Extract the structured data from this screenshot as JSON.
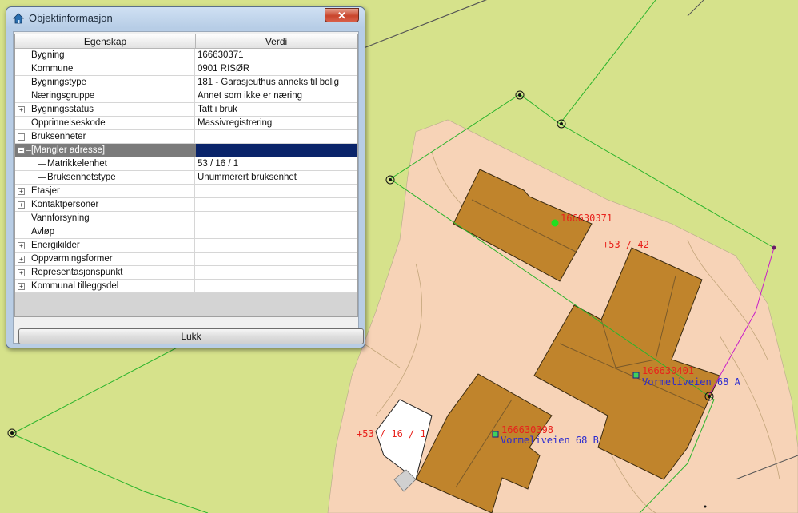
{
  "window": {
    "title": "Objektinformasjon",
    "close_glyph": "✕",
    "close_label": "Lukk"
  },
  "table": {
    "columns": [
      "Egenskap",
      "Verdi"
    ],
    "rows": [
      {
        "label": "Bygning",
        "value": "166630371",
        "expander": "",
        "indent": 0
      },
      {
        "label": "Kommune",
        "value": "0901  RISØR",
        "expander": "",
        "indent": 0
      },
      {
        "label": "Bygningstype",
        "value": "181 - Garasjeuthus anneks til bolig",
        "expander": "",
        "indent": 0
      },
      {
        "label": "Næringsgruppe",
        "value": "Annet som ikke er næring",
        "expander": "",
        "indent": 0
      },
      {
        "label": "Bygningsstatus",
        "value": "Tatt i bruk",
        "expander": "+",
        "indent": 0
      },
      {
        "label": "Opprinnelseskode",
        "value": "Massivregistrering",
        "expander": "",
        "indent": 0
      },
      {
        "label": "Bruksenheter",
        "value": "",
        "expander": "−",
        "indent": 0
      },
      {
        "label": "[Mangler adresse]",
        "value": "",
        "expander": "−",
        "indent": 1,
        "selected": true
      },
      {
        "label": "Matrikkelenhet",
        "value": "53 / 16 / 1",
        "expander": "",
        "indent": 2
      },
      {
        "label": "Bruksenhetstype",
        "value": "Unummerert bruksenhet",
        "expander": "",
        "indent": 2
      },
      {
        "label": "Etasjer",
        "value": "",
        "expander": "+",
        "indent": 0
      },
      {
        "label": "Kontaktpersoner",
        "value": "",
        "expander": "+",
        "indent": 0
      },
      {
        "label": "Vannforsyning",
        "value": "",
        "expander": "",
        "indent": 0
      },
      {
        "label": "Avløp",
        "value": "",
        "expander": "",
        "indent": 0
      },
      {
        "label": "Energikilder",
        "value": "",
        "expander": "+",
        "indent": 0
      },
      {
        "label": "Oppvarmingsformer",
        "value": "",
        "expander": "+",
        "indent": 0
      },
      {
        "label": "Representasjonspunkt",
        "value": "",
        "expander": "+",
        "indent": 0
      },
      {
        "label": "Kommunal tilleggsdel",
        "value": "",
        "expander": "+",
        "indent": 0
      }
    ]
  },
  "map": {
    "building_ids": [
      "166630371",
      "166630401",
      "166630398"
    ],
    "addresses": [
      "Vormeliveien 68 A",
      "Vormeliveien 68 B"
    ],
    "parcel_labels": [
      "+53 / 42",
      "+53 / 16 / 1"
    ],
    "colors": {
      "grass": "#d6e28b",
      "parcel": "#f7d3b7",
      "building": "#c0842c",
      "label_red": "#e8221c",
      "label_blue": "#2a2ad0",
      "boundary_green": "#2bb42b",
      "boundary_magenta": "#c81ec8"
    }
  },
  "icons": [
    "app-house-icon",
    "close-icon",
    "expand-plus-icon",
    "collapse-minus-icon"
  ]
}
